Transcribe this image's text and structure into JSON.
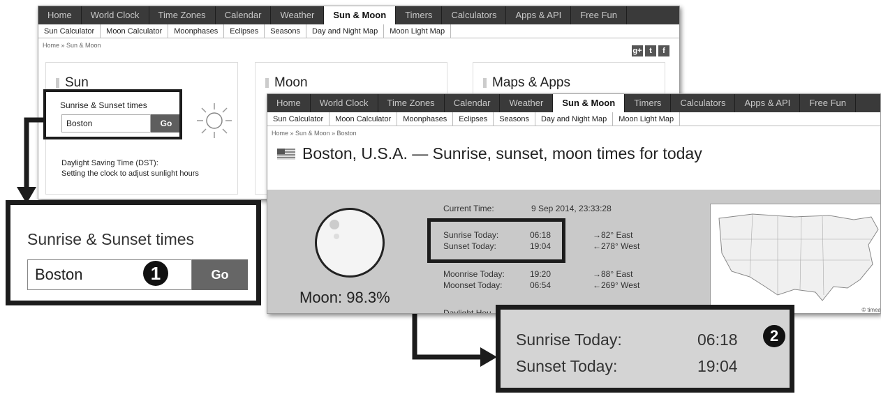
{
  "nav": {
    "items": [
      "Home",
      "World Clock",
      "Time Zones",
      "Calendar",
      "Weather",
      "Sun & Moon",
      "Timers",
      "Calculators",
      "Apps & API",
      "Free Fun"
    ],
    "active": "Sun & Moon"
  },
  "subnav": [
    "Sun Calculator",
    "Moon Calculator",
    "Moonphases",
    "Eclipses",
    "Seasons",
    "Day and Night Map",
    "Moon Light Map"
  ],
  "shot1": {
    "breadcrumb": "Home » Sun & Moon",
    "social": [
      "g+",
      "t",
      "f"
    ],
    "sun_panel": {
      "title": "Sun",
      "sunrise_label": "Sunrise & Sunset times",
      "input_value": "Boston",
      "go_label": "Go",
      "dst_line1": "Daylight Saving Time (DST):",
      "dst_line2": "Setting the clock to adjust sunlight hours"
    },
    "moon_panel": {
      "title": "Moon"
    },
    "maps_panel": {
      "title": "Maps & Apps"
    }
  },
  "callout1": {
    "label": "Sunrise & Sunset times",
    "input_value": "Boston",
    "go_label": "Go",
    "step": "1"
  },
  "shot2": {
    "breadcrumb": "Home » Sun & Moon » Boston",
    "title": "Boston, U.S.A. — Sunrise, sunset, moon times for today",
    "current_time_label": "Current Time:",
    "current_time_value": "9 Sep 2014, 23:33:28",
    "sunrise_label": "Sunrise Today:",
    "sunrise_value": "06:18",
    "sunrise_dir": "→82° East",
    "sunset_label": "Sunset Today:",
    "sunset_value": "19:04",
    "sunset_dir": "←278° West",
    "moonrise_label": "Moonrise Today:",
    "moonrise_value": "19:20",
    "moonrise_dir": "→88° East",
    "moonset_label": "Moonset Today:",
    "moonset_value": "06:54",
    "moonset_dir": "←269° West",
    "daylight_label": "Daylight Hou",
    "moon_label": "Moon: 98.3%",
    "map_credit": "© timea"
  },
  "callout2": {
    "sunrise_label": "Sunrise Today:",
    "sunrise_value": "06:18",
    "sunset_label": "Sunset Today:",
    "sunset_value": "19:04",
    "step": "2"
  }
}
